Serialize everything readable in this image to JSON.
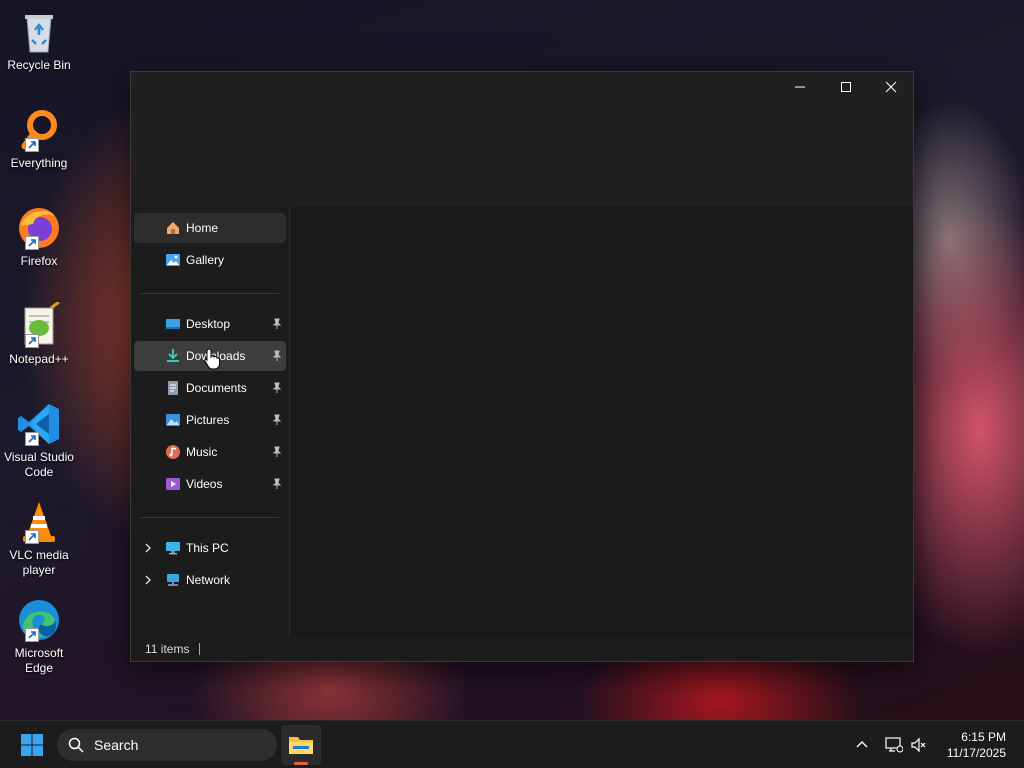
{
  "desktop": {
    "icons": [
      {
        "label": "Recycle Bin"
      },
      {
        "label": "Everything"
      },
      {
        "label": "Firefox"
      },
      {
        "label": "Notepad++"
      },
      {
        "label": "Visual Studio Code"
      },
      {
        "label": "VLC media player"
      },
      {
        "label": "Microsoft Edge"
      }
    ]
  },
  "window": {
    "nav": {
      "home": "Home",
      "gallery": "Gallery",
      "desktop": "Desktop",
      "downloads": "Downloads",
      "documents": "Documents",
      "pictures": "Pictures",
      "music": "Music",
      "videos": "Videos",
      "this_pc": "This PC",
      "network": "Network"
    },
    "status": {
      "items": "11 items"
    }
  },
  "taskbar": {
    "search_label": "Search",
    "clock_time": "6:15 PM",
    "clock_date": "11/17/2025"
  },
  "colors": {
    "accent": "#0078d4",
    "window_bg": "#1c1c1c",
    "taskbar_bg": "#1c1c1e"
  }
}
